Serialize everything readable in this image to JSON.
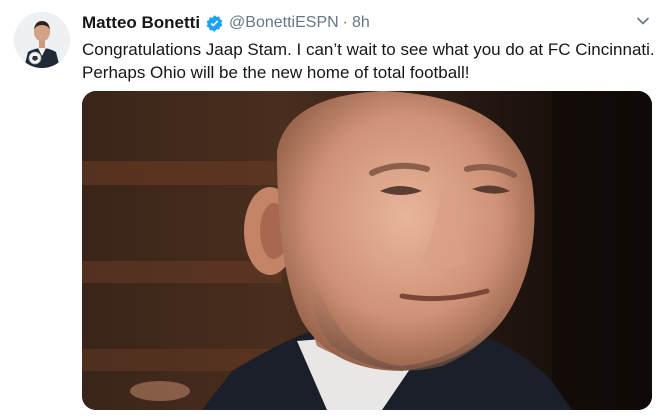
{
  "tweet": {
    "author": {
      "display_name": "Matteo Bonetti",
      "handle": "@BonettiESPN",
      "verified": true
    },
    "separator": "·",
    "time": "8h",
    "text_lines": [
      "Congratulations Jaap Stam. I can’t wait to see what you do at FC Cincinnati.",
      "Perhaps Ohio will be the new home of total football!"
    ],
    "media": {
      "kind": "photo",
      "subject": "portrait-of-bald-man-in-dark-suit"
    },
    "icons": {
      "verified": "verified-badge-icon",
      "menu": "chevron-down-icon"
    }
  },
  "colors": {
    "name": "#14171a",
    "secondary": "#657786",
    "verified": "#1da1f2",
    "background": "#ffffff"
  }
}
